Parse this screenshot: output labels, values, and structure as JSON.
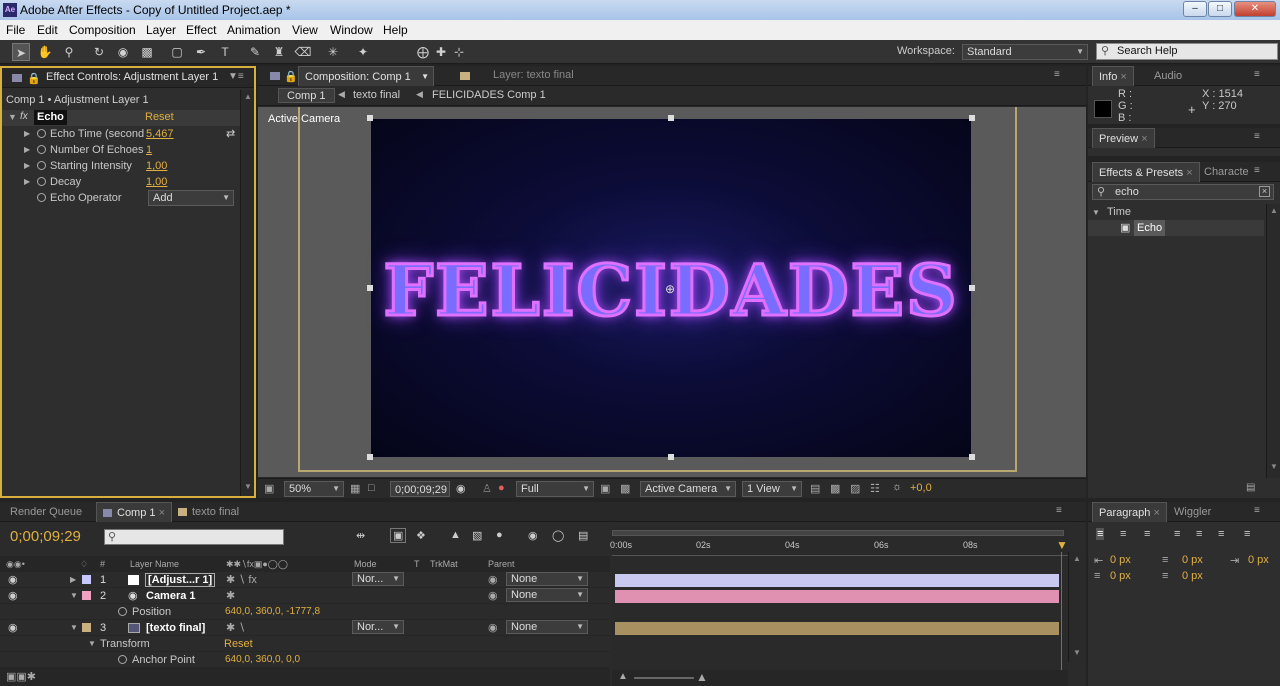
{
  "window": {
    "title": "Adobe After Effects - Copy of Untitled Project.aep *",
    "app_icon": "Ae"
  },
  "menu": [
    "File",
    "Edit",
    "Composition",
    "Layer",
    "Effect",
    "Animation",
    "View",
    "Window",
    "Help"
  ],
  "workspace": {
    "label": "Workspace:",
    "value": "Standard",
    "search_placeholder": "Search Help"
  },
  "effect_controls": {
    "tab": "Effect Controls: Adjustment Layer 1",
    "breadcrumb": "Comp 1 • Adjustment Layer 1",
    "effect_name": "Echo",
    "reset": "Reset",
    "props": [
      {
        "name": "Echo Time (second",
        "value": "5,467"
      },
      {
        "name": "Number Of Echoes",
        "value": "1"
      },
      {
        "name": "Starting Intensity",
        "value": "1,00"
      },
      {
        "name": "Decay",
        "value": "1,00"
      },
      {
        "name": "Echo Operator",
        "value": "Add"
      }
    ]
  },
  "composition": {
    "tab": "Composition: Comp 1",
    "layer_tab": "Layer: texto final",
    "crumbs": [
      "Comp 1",
      "texto final",
      "FELICIDADES Comp 1"
    ],
    "view_label": "Active Camera",
    "canvas_text": "FELICIDADES",
    "footer": {
      "zoom": "50%",
      "timecode": "0;00;09;29",
      "resolution": "Full",
      "camera": "Active Camera",
      "views": "1 View",
      "exposure": "+0,0"
    }
  },
  "info": {
    "tabs": [
      "Info",
      "Audio"
    ],
    "r": "R :",
    "g": "G :",
    "b": "B :",
    "x": "X : 1514",
    "y": "Y : 270"
  },
  "preview": {
    "tab": "Preview"
  },
  "effects_presets": {
    "tabs": [
      "Effects & Presets",
      "Characte"
    ],
    "search": "echo",
    "category": "Time",
    "item": "Echo"
  },
  "timeline": {
    "tabs": [
      "Render Queue",
      "Comp 1",
      "texto final"
    ],
    "timecode": "0;00;09;29",
    "columns": {
      "name": "Layer Name",
      "mode": "Mode",
      "t": "T",
      "trkmat": "TrkMat",
      "parent": "Parent",
      "num": "#"
    },
    "ruler": [
      "0:00s",
      "02s",
      "04s",
      "06s",
      "08s"
    ],
    "layers": [
      {
        "num": "1",
        "name": "[Adjust...r 1]",
        "mode": "Nor...",
        "parent": "None",
        "color": "#c8c8ff"
      },
      {
        "num": "2",
        "name": "Camera 1",
        "mode": "",
        "parent": "None",
        "color": "#f0a0c0"
      },
      {
        "prop": "Position",
        "value": "640,0, 360,0, -1777,8"
      },
      {
        "num": "3",
        "name": "[texto final]",
        "mode": "Nor...",
        "parent": "None",
        "color": "#c8b080"
      },
      {
        "group": "Transform",
        "reset": "Reset"
      },
      {
        "prop": "Anchor Point",
        "value": "640,0, 360,0, 0,0"
      }
    ]
  },
  "paragraph": {
    "tabs": [
      "Paragraph",
      "Wiggler"
    ],
    "px_values": [
      "0 px",
      "0 px",
      "0 px",
      "0 px",
      "0 px"
    ]
  }
}
